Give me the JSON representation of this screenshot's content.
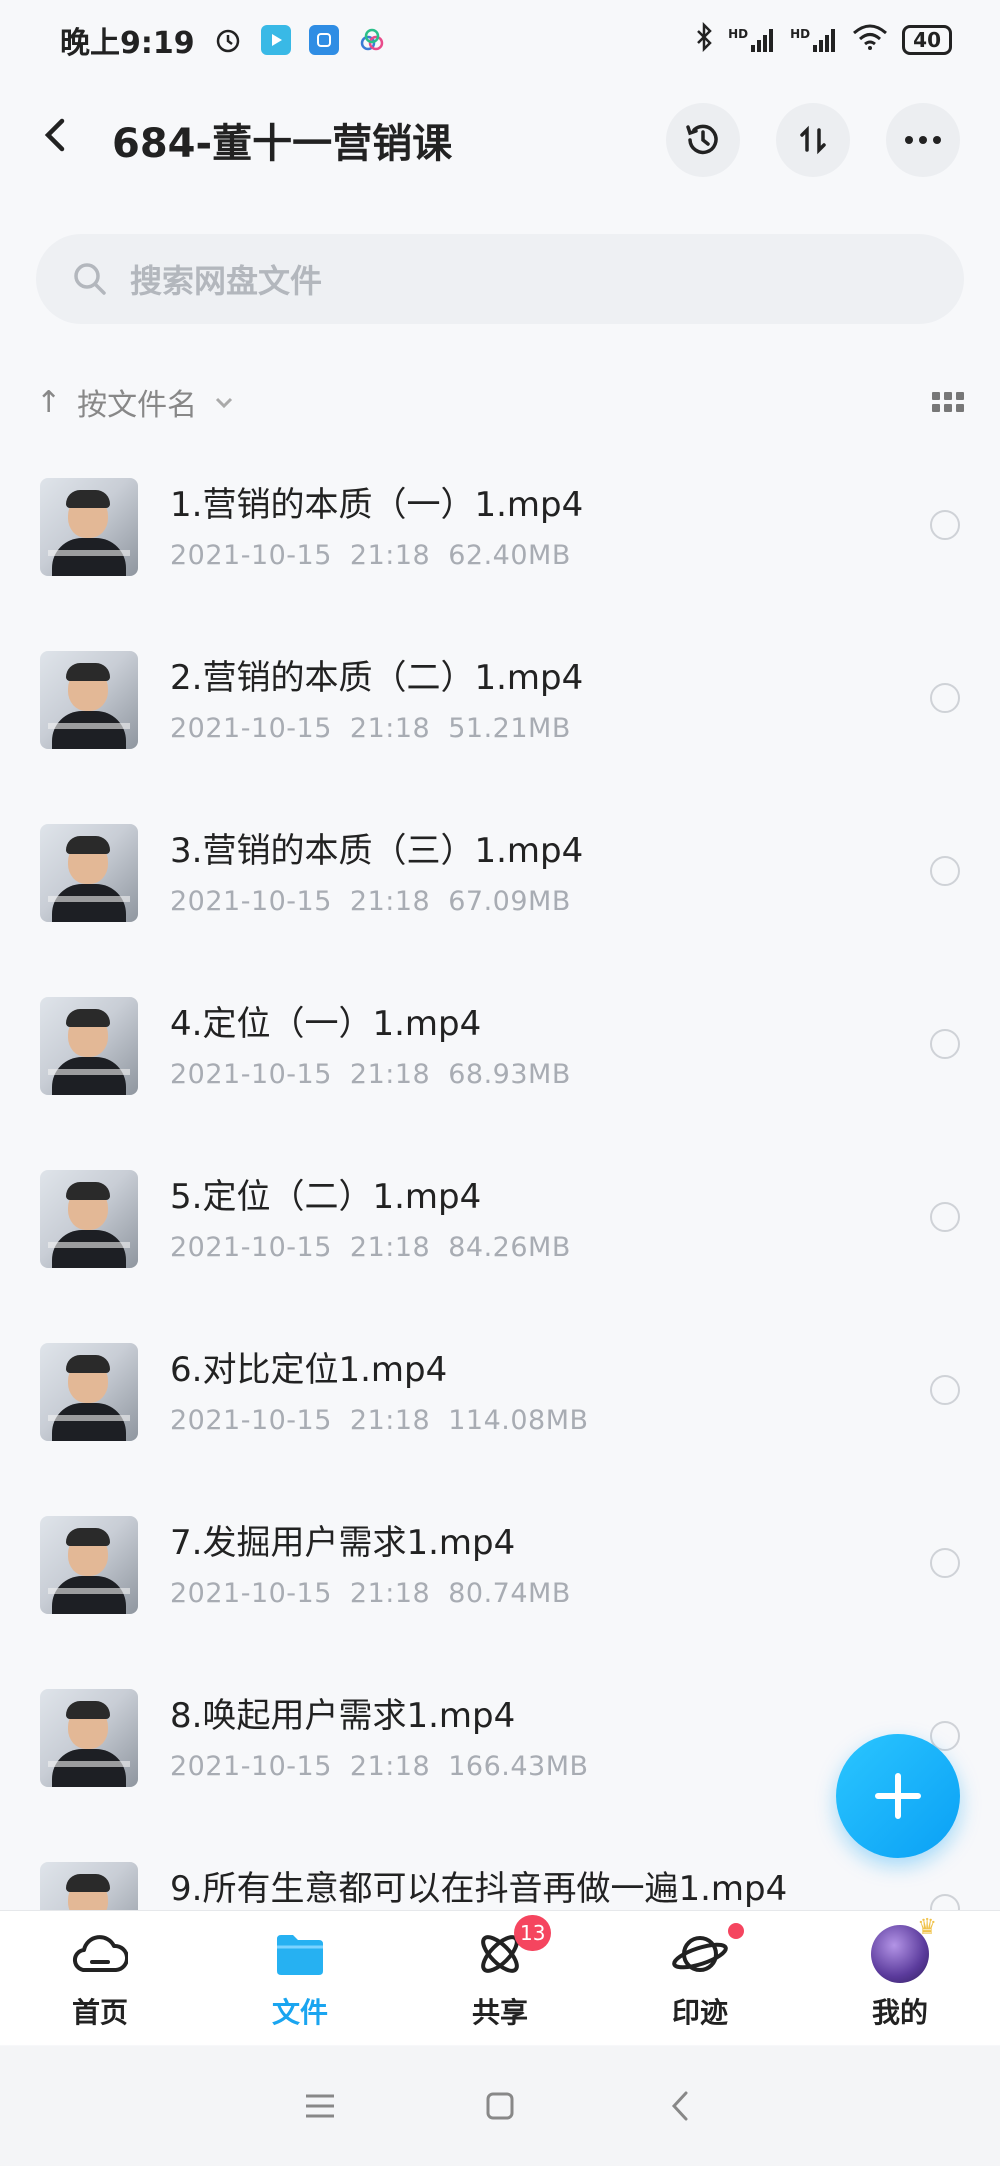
{
  "status": {
    "time": "晚上9:19",
    "battery": "40",
    "signal1": "HD",
    "signal2": "HD"
  },
  "header": {
    "title": "684-董十一营销课",
    "back_icon": "back-arrow-icon",
    "actions": [
      "history-icon",
      "sort-transfer-icon",
      "more-icon"
    ]
  },
  "search": {
    "placeholder": "搜索网盘文件"
  },
  "sort": {
    "label": "按文件名"
  },
  "files": [
    {
      "name": "1.营销的本质（一）1.mp4",
      "date": "2021-10-15",
      "time": "21:18",
      "size": "62.40MB"
    },
    {
      "name": "2.营销的本质（二）1.mp4",
      "date": "2021-10-15",
      "time": "21:18",
      "size": "51.21MB"
    },
    {
      "name": "3.营销的本质（三）1.mp4",
      "date": "2021-10-15",
      "time": "21:18",
      "size": "67.09MB"
    },
    {
      "name": "4.定位（一）1.mp4",
      "date": "2021-10-15",
      "time": "21:18",
      "size": "68.93MB"
    },
    {
      "name": "5.定位（二）1.mp4",
      "date": "2021-10-15",
      "time": "21:18",
      "size": "84.26MB"
    },
    {
      "name": "6.对比定位1.mp4",
      "date": "2021-10-15",
      "time": "21:18",
      "size": "114.08MB"
    },
    {
      "name": "7.发掘用户需求1.mp4",
      "date": "2021-10-15",
      "time": "21:18",
      "size": "80.74MB"
    },
    {
      "name": "8.唤起用户需求1.mp4",
      "date": "2021-10-15",
      "time": "21:18",
      "size": "166.43MB"
    },
    {
      "name": "9.所有生意都可以在抖音再做一遍1.mp4",
      "date": "",
      "time": "",
      "size": ""
    }
  ],
  "nav": {
    "items": [
      {
        "label": "首页",
        "icon": "cloud-home-icon"
      },
      {
        "label": "文件",
        "icon": "folder-icon"
      },
      {
        "label": "共享",
        "icon": "atom-share-icon",
        "badge": "13"
      },
      {
        "label": "印迹",
        "icon": "planet-icon"
      },
      {
        "label": "我的",
        "icon": "avatar"
      }
    ]
  },
  "colors": {
    "accent": "#1aa5f0",
    "badge": "#f5455f"
  }
}
